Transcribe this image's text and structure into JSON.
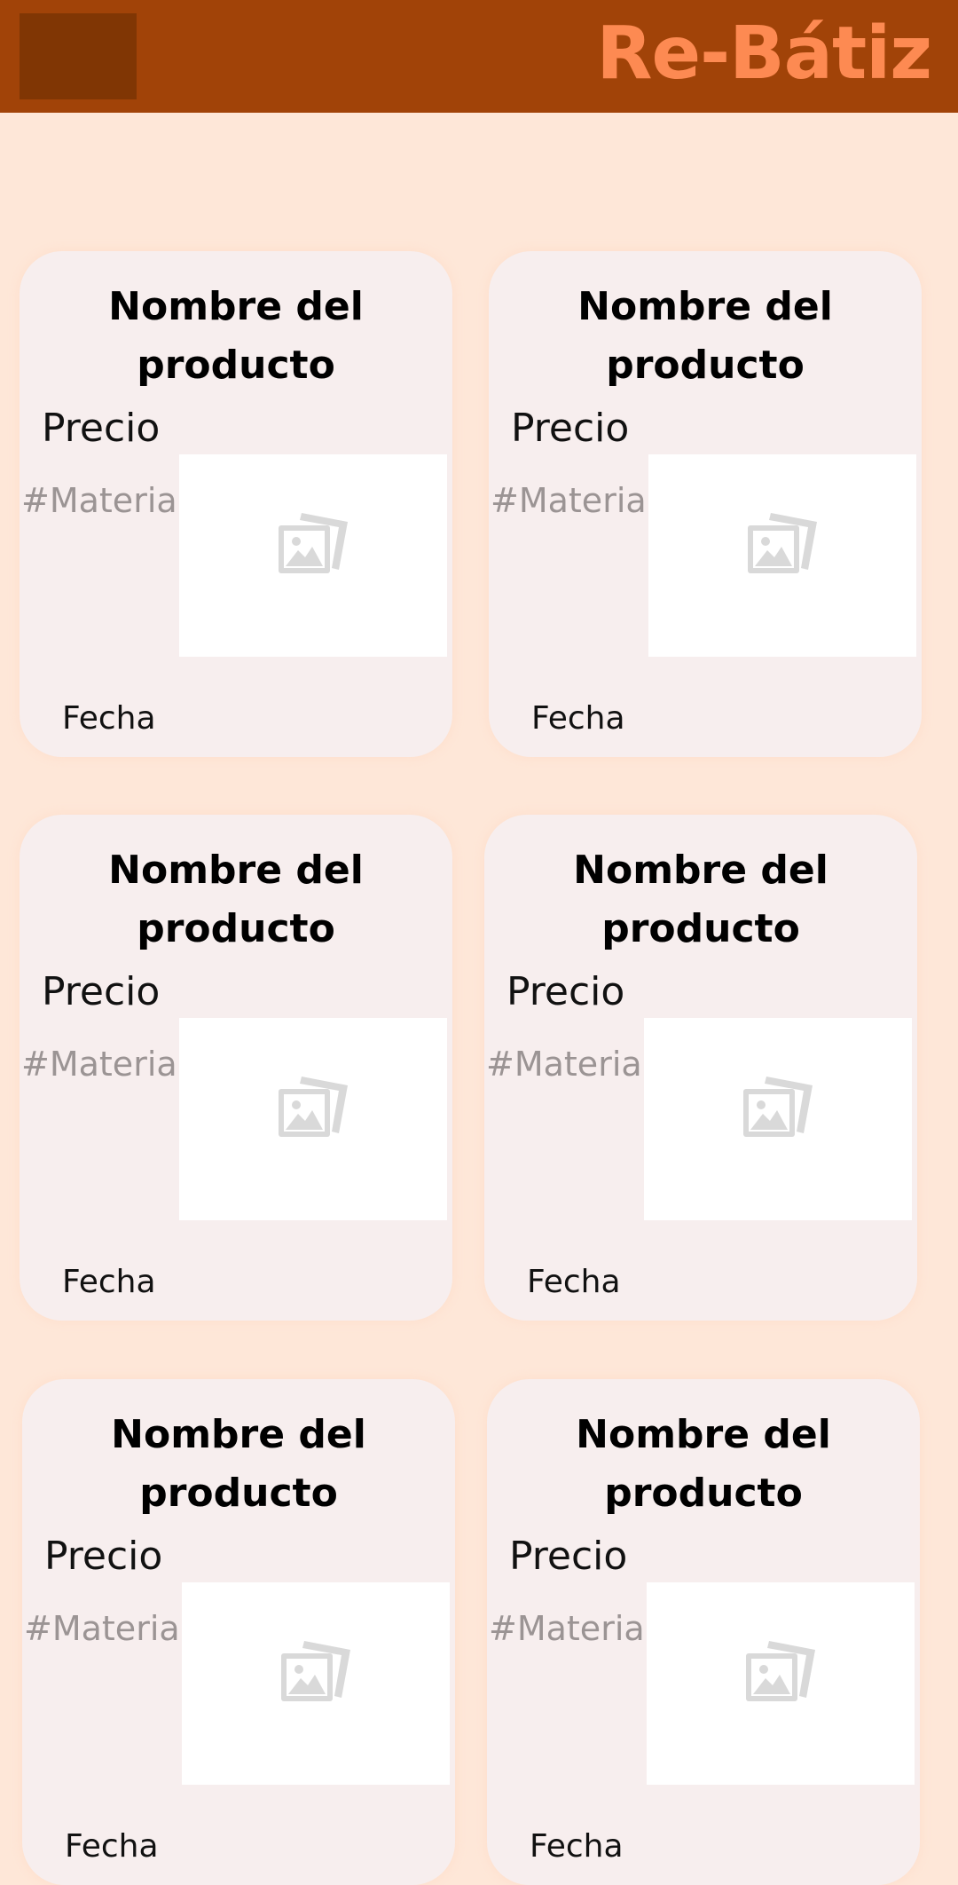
{
  "header": {
    "brand": "Re-Bátiz",
    "menu_button": "menu-button",
    "bg_color": "#a14308",
    "brand_color": "#fd8a52"
  },
  "products": [
    {
      "title": "Nombre del producto",
      "price": "Precio",
      "tag": "#Materia",
      "date": "Fecha",
      "image_icon": "image-placeholder-icon"
    },
    {
      "title": "Nombre del producto",
      "price": "Precio",
      "tag": "#Materia",
      "date": "Fecha",
      "image_icon": "image-placeholder-icon"
    },
    {
      "title": "Nombre del producto",
      "price": "Precio",
      "tag": "#Materia",
      "date": "Fecha",
      "image_icon": "image-placeholder-icon"
    },
    {
      "title": "Nombre del producto",
      "price": "Precio",
      "tag": "#Materia",
      "date": "Fecha",
      "image_icon": "image-placeholder-icon"
    },
    {
      "title": "Nombre del producto",
      "price": "Precio",
      "tag": "#Materia",
      "date": "Fecha",
      "image_icon": "image-placeholder-icon"
    },
    {
      "title": "Nombre del producto",
      "price": "Precio",
      "tag": "#Materia",
      "date": "Fecha",
      "image_icon": "image-placeholder-icon"
    }
  ],
  "colors": {
    "page_bg": "#fee7d8",
    "card_bg": "#f7eeee",
    "tag_text": "#9b9494"
  }
}
